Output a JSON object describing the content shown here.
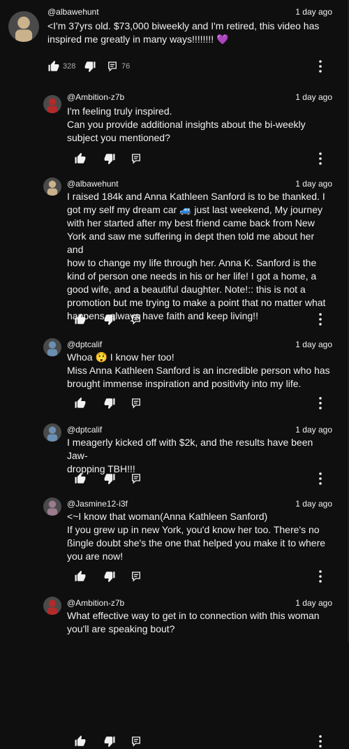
{
  "comments": [
    {
      "author": "@albawehunt",
      "time": "1 day ago",
      "text": "<I'm 37yrs old. $73,000 biweekly and I'm retired, this video has\ninspired me greatly in many ways!!!!!!!! 💜",
      "likes": "328",
      "replies": "76",
      "avatar_color": "#c9b28c"
    },
    {
      "author": "@Ambition-z7b",
      "time": "1 day ago",
      "text": "I'm feeling truly inspired.\nCan you provide additional insights about the bi-weekly\nsubject you mentioned?",
      "avatar_color": "#b32a2a"
    },
    {
      "author": "@albawehunt",
      "time": "1 day ago",
      "text": "I raised 184k and Anna Kathleen Sanford is to be thanked. I\ngot my self my dream car 🚙 just last weekend, My journey\nwith her started after my best friend came back from New\nYork and saw me suffering in dept then told me about her and\nhow to change my life through her. Anna K. Sanford is the\nkind of person one needs in his or her life! I got a home, a\ngood wife, and a beautiful daughter. Note!:: this is not a\npromotion but me trying to make a point that no matter what\nhappens, always have faith and keep living!!",
      "avatar_color": "#c9b28c"
    },
    {
      "author": "@dptcalif",
      "time": "1 day ago",
      "text": "Whoa 😲 I know her too!\nMiss Anna Kathleen Sanford is an incredible person who has\nbrought immense inspiration and positivity into my life.",
      "avatar_color": "#6b8fb0"
    },
    {
      "author": "@dptcalif",
      "time": "1 day ago",
      "text": "I meagerly kicked off with $2k, and the results have been Jaw-\ndropping TBH!!!",
      "avatar_color": "#6b8fb0"
    },
    {
      "author": "@Jasmine12-i3f",
      "time": "1 day ago",
      "text": "<~I know that woman(Anna Kathleen Sanford)\n If you grew up in new York, you'd know her too. There's no\nßingle doubt she's the one that helped you make it to where\nyou are now!",
      "avatar_color": "#9b7b8e"
    },
    {
      "author": "@Ambition-z7b",
      "time": "1 day ago",
      "text": "What effective way to get in to connection with this woman\nyou'll are speaking bout?",
      "avatar_color": "#b32a2a"
    }
  ],
  "icons": {
    "like": "thumb-up-icon",
    "dislike": "thumb-down-icon",
    "reply": "reply-icon",
    "menu": "more-vert-icon"
  }
}
